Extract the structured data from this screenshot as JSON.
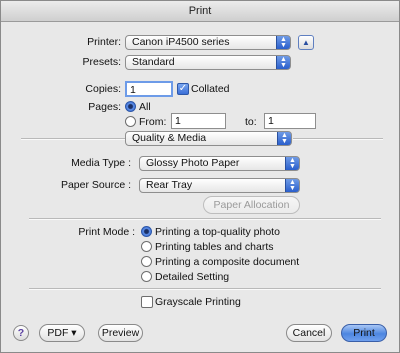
{
  "window": {
    "title": "Print"
  },
  "printer": {
    "label": "Printer:",
    "value": "Canon iP4500 series"
  },
  "presets": {
    "label": "Presets:",
    "value": "Standard"
  },
  "copies": {
    "label": "Copies:",
    "value": "1",
    "collated_label": "Collated",
    "collated_checked": true
  },
  "pages": {
    "label": "Pages:",
    "all_label": "All",
    "from_label": "From:",
    "from_value": "1",
    "to_label": "to:",
    "to_value": "1",
    "selected": "All"
  },
  "panel": {
    "value": "Quality & Media"
  },
  "media_type": {
    "label": "Media Type :",
    "value": "Glossy Photo Paper"
  },
  "paper_source": {
    "label": "Paper Source :",
    "value": "Rear Tray"
  },
  "paper_allocation": {
    "label": "Paper Allocation"
  },
  "print_mode": {
    "label": "Print Mode :",
    "options": [
      "Printing a top-quality photo",
      "Printing tables and charts",
      "Printing a composite document",
      "Detailed Setting"
    ],
    "selected": "Printing a top-quality photo"
  },
  "grayscale": {
    "label": "Grayscale Printing",
    "checked": false
  },
  "footer": {
    "help": "?",
    "pdf": "PDF ▾",
    "preview": "Preview",
    "cancel": "Cancel",
    "print": "Print"
  }
}
